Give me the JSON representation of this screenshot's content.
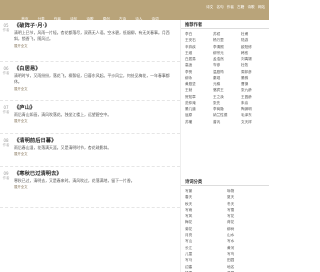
{
  "nav": {
    "items": [
      "首页",
      "分类",
      "作者",
      "诗句",
      "诗歌",
      "原创",
      "古诗",
      "诗人",
      "诗词"
    ],
    "utils": [
      "诗文",
      "名句",
      "作者",
      "古籍",
      "诗歌",
      "网站"
    ]
  },
  "posts": [
    {
      "date": "05",
      "sub": "作者",
      "title": "《破阵子·月·》",
      "excerpt": "清明上巳节，风雨一片轻。杏花都落尽，双燕无人语。空水碧，低烟柳，有无关春事。月西斜，锁香飞，随风过。",
      "more": "展开全文"
    },
    {
      "date": "06",
      "sub": "作者",
      "title": "《白居易》",
      "excerpt": "清明时节，又雨纷纷，落花飞，柳絮轻，日暮东风起。平沙风尘，何处见梅花，一年春事都休。",
      "more": "展开全文"
    },
    {
      "date": "07",
      "sub": "作者",
      "title": "《庐山》",
      "excerpt": "雨后青山如画，清风吹落花。独坐江楼上，远望碧空中。",
      "more": "展开全文"
    },
    {
      "date": "08",
      "sub": "作者",
      "title": "《清明前后日暮》",
      "excerpt": "雨后春山湿，花落满天涯。又是清明时节，杏花疏影斜。",
      "more": "展开全文"
    },
    {
      "date": "09",
      "sub": "作者",
      "title": "《寒秋已过清明去》",
      "excerpt": "寒秋已过，清明去，又是春来时。清风吹过，花落满地，留下一片香。",
      "more": "展开全文"
    }
  ],
  "sidebar": {
    "authors_title": "推荐作者",
    "authors": [
      "李白",
      "苏轼",
      "杜甫",
      "王安石",
      "杨万里",
      "陆游",
      "辛弃疾",
      "李清照",
      "欧阳修",
      "王维",
      "柳宗元",
      "韩愈",
      "白居易",
      "孟浩然",
      "刘禹锡",
      "高适",
      "岑参",
      "杜牧",
      "李贺",
      "温庭筠",
      "周邦彦",
      "柳永",
      "秦观",
      "晏殊",
      "黄庭坚",
      "元稹",
      "曹操",
      "王勃",
      "骆宾王",
      "张九龄",
      "贺知章",
      "王之涣",
      "王昌龄",
      "范仲淹",
      "张先",
      "朱熹",
      "晏几道",
      "李商隐",
      "陶渊明",
      "屈原",
      "纳兰性德",
      "毛泽东",
      "苏辙",
      "曾巩",
      "文天祥"
    ],
    "poems_title": "诗词分类",
    "poems": [
      "写景",
      "咏物",
      "春天",
      "夏天",
      "秋天",
      "冬天",
      "写雨",
      "写雪",
      "写风",
      "写花",
      "梅花",
      "荷花",
      "菊花",
      "柳树",
      "月亮",
      "山水",
      "写山",
      "写水",
      "长江",
      "黄河",
      "儿童",
      "写鸟",
      "写马",
      "田园",
      "边塞",
      "地名",
      "抒情",
      "爱国",
      "离别",
      "送别"
    ]
  }
}
